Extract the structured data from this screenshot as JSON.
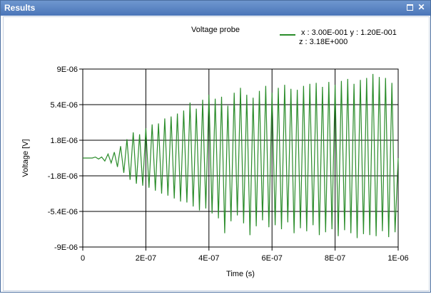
{
  "window": {
    "title": "Results",
    "maximize_icon": "maximize-icon",
    "close_icon": "close-icon",
    "close_glyph": "✕"
  },
  "chart_data": {
    "type": "line",
    "title": "Voltage probe",
    "xlabel": "Time (s)",
    "ylabel": "Voltage [V]",
    "xlim": [
      0,
      1e-06
    ],
    "ylim": [
      -9e-06,
      9e-06
    ],
    "x_ticks": [
      0,
      2e-07,
      4e-07,
      6e-07,
      8e-07,
      1e-06
    ],
    "x_tick_labels": [
      "0",
      "2E-07",
      "4E-07",
      "6E-07",
      "8E-07",
      "1E-06"
    ],
    "y_ticks": [
      9e-06,
      5.4e-06,
      1.8e-06,
      -1.8e-06,
      -5.4e-06,
      -9e-06
    ],
    "y_tick_labels": [
      "9E-06",
      "5.4E-06",
      "1.8E-06",
      "-1.8E-06",
      "-5.4E-06",
      "-9E-06"
    ],
    "grid": true,
    "legend_position": "top-right",
    "series_color": "#2a8c2a",
    "legend": {
      "line1": "x : 3.00E-001   y : 1.20E-001",
      "line2": "z : 3.18E+000"
    },
    "series": [
      {
        "x": [
          0,
          1e-08,
          2e-08,
          3e-08,
          4e-08,
          5e-08,
          6e-08,
          7e-08,
          8e-08,
          9e-08,
          1e-07,
          1.1e-07,
          1.2e-07,
          1.3e-07,
          1.4e-07,
          1.5e-07,
          1.6e-07,
          1.7e-07,
          1.8e-07,
          1.9e-07,
          2e-07,
          2.1e-07,
          2.2e-07,
          2.3e-07,
          2.4e-07,
          2.5e-07,
          2.6e-07,
          2.7e-07,
          2.8e-07,
          2.9e-07,
          3e-07,
          3.1e-07,
          3.2e-07,
          3.3e-07,
          3.4e-07,
          3.5e-07,
          3.6e-07,
          3.7e-07,
          3.8e-07,
          3.9e-07,
          4e-07,
          4.1e-07,
          4.2e-07,
          4.3e-07,
          4.4e-07,
          4.5e-07,
          4.6e-07,
          4.7e-07,
          4.8e-07,
          4.9e-07,
          5e-07,
          5.1e-07,
          5.2e-07,
          5.3e-07,
          5.4e-07,
          5.5e-07,
          5.6e-07,
          5.7e-07,
          5.8e-07,
          5.9e-07,
          6e-07,
          6.1e-07,
          6.2e-07,
          6.3e-07,
          6.4e-07,
          6.5e-07,
          6.6e-07,
          6.7e-07,
          6.8e-07,
          6.9e-07,
          7e-07,
          7.1e-07,
          7.2e-07,
          7.3e-07,
          7.4e-07,
          7.5e-07,
          7.6e-07,
          7.7e-07,
          7.8e-07,
          7.9e-07,
          8e-07,
          8.1e-07,
          8.2e-07,
          8.3e-07,
          8.4e-07,
          8.5e-07,
          8.6e-07,
          8.7e-07,
          8.8e-07,
          8.9e-07,
          9e-07,
          9.1e-07,
          9.2e-07,
          9.3e-07,
          9.4e-07,
          9.5e-07,
          9.6e-07,
          9.7e-07,
          9.8e-07,
          9.9e-07,
          1e-06
        ],
        "y": [
          0,
          0,
          0,
          0,
          1e-07,
          -1e-07,
          1e-07,
          -3e-07,
          4e-07,
          -5e-07,
          6e-07,
          -9e-07,
          1.2e-06,
          -1.5e-06,
          1.9e-06,
          -2.2e-06,
          2.6e-06,
          -2.6e-06,
          2.4e-06,
          -2.8e-06,
          3e-06,
          -3e-06,
          3.4e-06,
          -3.3e-06,
          3.5e-06,
          -3.6e-06,
          4e-06,
          -3.8e-06,
          4.2e-06,
          -4.1e-06,
          4.5e-06,
          -4.4e-06,
          4.8e-06,
          -4.5e-06,
          5.6e-06,
          -4.9e-06,
          5e-06,
          -5.3e-06,
          5.9e-06,
          -5.1e-06,
          6.4e-06,
          -5.6e-06,
          6e-06,
          -6.1e-06,
          6.2e-06,
          -7.6e-06,
          5.3e-06,
          -6.4e-06,
          6.6e-06,
          -5.8e-06,
          7.1e-06,
          -6.6e-06,
          6.4e-06,
          -7.8e-06,
          6.1e-06,
          -6.9e-06,
          6.8e-06,
          -6.3e-06,
          7.3e-06,
          -7e-06,
          6.6e-06,
          -6.8e-06,
          7.1e-06,
          -7.2e-06,
          7.4e-06,
          -6.5e-06,
          7e-06,
          -7.6e-06,
          6.9e-06,
          -7.1e-06,
          7.3e-06,
          -7.4e-06,
          7.5e-06,
          -6.8e-06,
          7.6e-06,
          -7.8e-06,
          7.2e-06,
          -7.5e-06,
          7.7e-06,
          -7.2e-06,
          7.4e-06,
          -7.9e-06,
          7.8e-06,
          -7.3e-06,
          8e-06,
          -7.6e-06,
          7.5e-06,
          -8.1e-06,
          7.9e-06,
          -7.7e-06,
          8.1e-06,
          -7.8e-06,
          8.5e-06,
          -7.9e-06,
          8.2e-06,
          -7.4e-06,
          8.1e-06,
          -8e-06,
          7.6e-06,
          -7.5e-06,
          0
        ]
      }
    ]
  }
}
